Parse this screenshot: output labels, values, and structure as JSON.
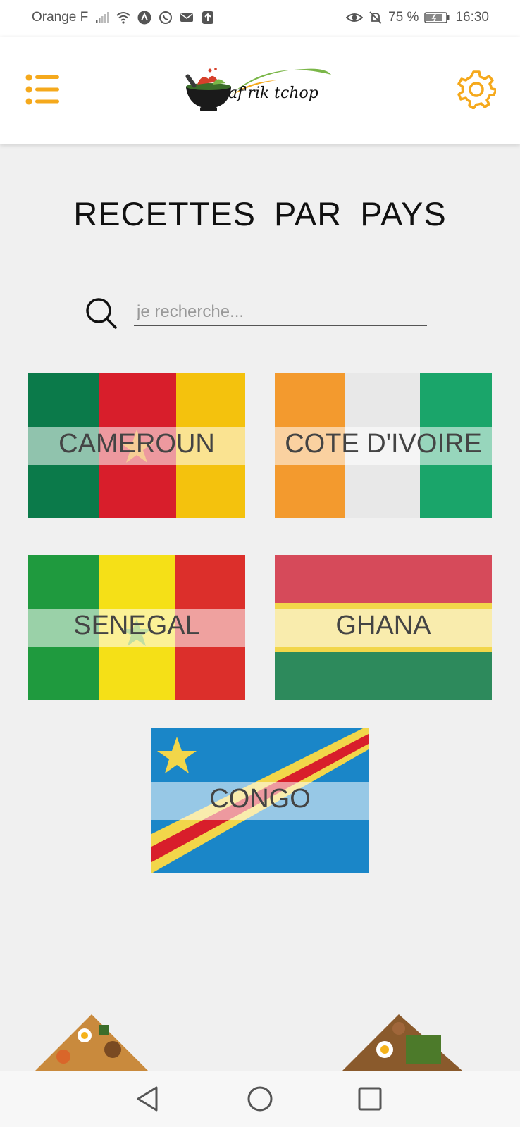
{
  "status_bar": {
    "carrier": "Orange F",
    "battery": "75 %",
    "time": "16:30",
    "icons_left": [
      "signal-icon",
      "wifi-icon",
      "app-a-icon",
      "whatsapp-icon",
      "mail-icon",
      "upload-icon"
    ],
    "icons_right": [
      "eye-icon",
      "bell-off-icon",
      "battery-icon"
    ]
  },
  "app_bar": {
    "logo_text": "af'rik tchop",
    "accent_color": "#f5a91c"
  },
  "page": {
    "title": "RECETTES  PAR  PAYS"
  },
  "search": {
    "placeholder": "je recherche..."
  },
  "countries": [
    {
      "label": "CAMEROUN"
    },
    {
      "label": "COTE D'IVOIRE"
    },
    {
      "label": "SENEGAL"
    },
    {
      "label": "GHANA"
    },
    {
      "label": "CONGO"
    }
  ],
  "nav": {
    "icons": [
      "back-icon",
      "home-icon",
      "recents-icon"
    ]
  }
}
